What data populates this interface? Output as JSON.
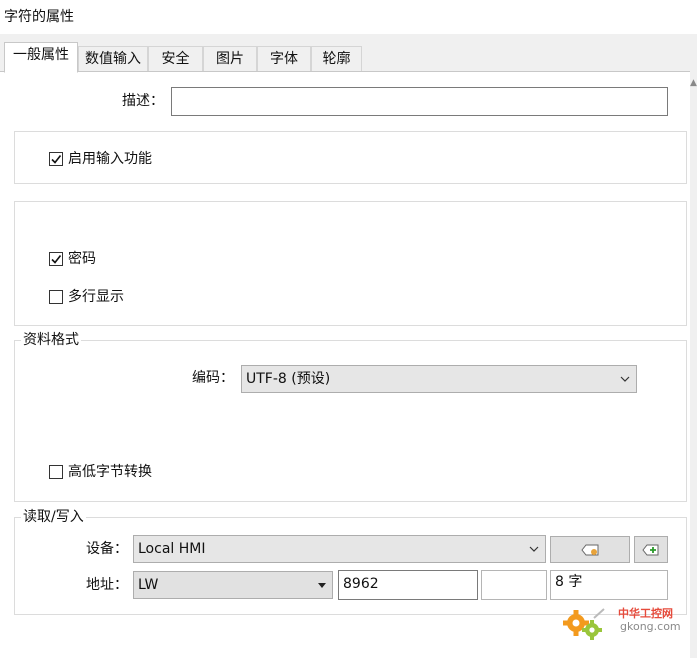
{
  "window": {
    "title": "字符的属性"
  },
  "tabs": [
    {
      "label": "一般属性",
      "active": true
    },
    {
      "label": "数值输入",
      "active": false
    },
    {
      "label": "安全",
      "active": false
    },
    {
      "label": "图片",
      "active": false
    },
    {
      "label": "字体",
      "active": false
    },
    {
      "label": "轮廓",
      "active": false
    }
  ],
  "description": {
    "label": "描述：",
    "value": ""
  },
  "input_enable": {
    "label": "启用输入功能",
    "checked": true
  },
  "options": {
    "password": {
      "label": "密码",
      "checked": true
    },
    "multiline": {
      "label": "多行显示",
      "checked": false
    }
  },
  "data_format": {
    "title": "资料格式",
    "encoding_label": "编码：",
    "encoding_value": "UTF-8 (预设)",
    "byte_swap": {
      "label": "高低字节转换",
      "checked": false
    }
  },
  "read_write": {
    "title": "读取/写入",
    "device_label": "设备：",
    "device_value": "Local HMI",
    "address_label": "地址：",
    "address_type": "LW",
    "address_value": "8962",
    "address_extra": "",
    "length_value": "8 字"
  },
  "watermark": {
    "text_cn": "中华工控网",
    "text_en": "gkong.com"
  },
  "colors": {
    "accent": "#0078d7",
    "watermark_orange": "#f39a1e",
    "watermark_green": "#9ac63b"
  }
}
